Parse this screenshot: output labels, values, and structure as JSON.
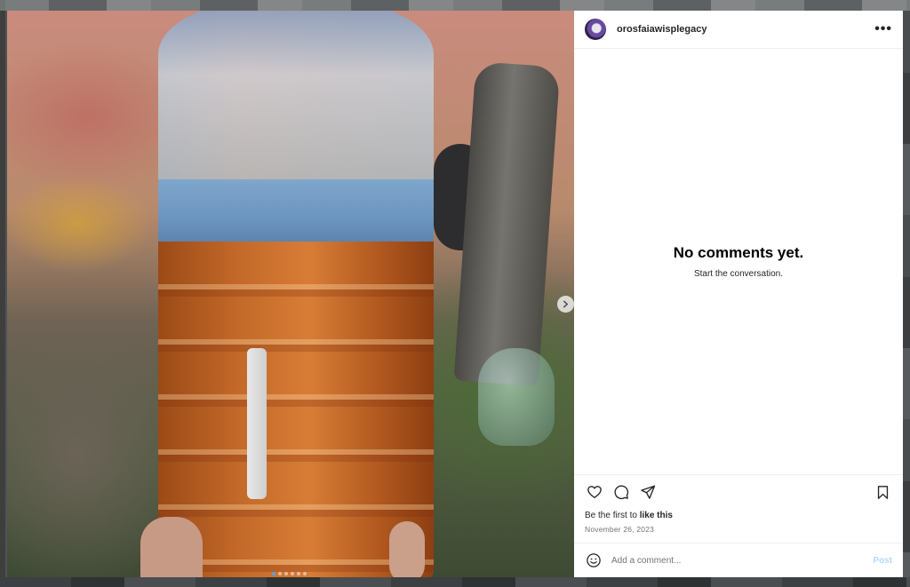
{
  "post": {
    "username": "orosfaiawisplegacy",
    "more_label": "•••",
    "carousel_count": 6,
    "carousel_active": 1
  },
  "comments": {
    "empty_title": "No comments yet.",
    "empty_subtitle": "Start the conversation."
  },
  "likes": {
    "prefix": "Be the first to ",
    "link": "like this"
  },
  "date": "November 26, 2023",
  "comment_box": {
    "placeholder": "Add a comment...",
    "post_label": "Post"
  },
  "colors": {
    "post_button": "#b3dbff",
    "active_dot": "#4aa3ff"
  },
  "icons": [
    "heart-icon",
    "comment-icon",
    "share-icon",
    "bookmark-icon",
    "emoji-icon",
    "chevron-right-icon",
    "more-icon"
  ]
}
